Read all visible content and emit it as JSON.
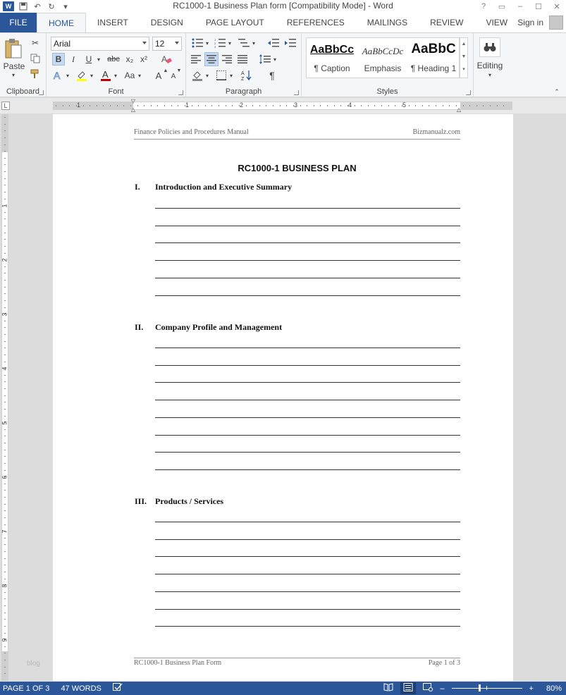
{
  "window": {
    "title": "RC1000-1 Business Plan form [Compatibility Mode] - Word",
    "controls": [
      "?",
      "▭",
      "–",
      "☐",
      "✕"
    ]
  },
  "ribbon_tabs": {
    "file": "FILE",
    "tabs": [
      "HOME",
      "INSERT",
      "DESIGN",
      "PAGE LAYOUT",
      "REFERENCES",
      "MAILINGS",
      "REVIEW",
      "VIEW"
    ],
    "active": "HOME",
    "sign_in": "Sign in"
  },
  "ribbon": {
    "clipboard": {
      "label": "Clipboard",
      "paste_label": "Paste"
    },
    "font": {
      "label": "Font",
      "font_name": "Arial",
      "font_size": "12",
      "bold": "B",
      "italic": "I",
      "underline": "U",
      "strike": "abc",
      "subscript": "x₂",
      "superscript": "x²",
      "grow": "A",
      "shrink": "A",
      "change_case": "Aa",
      "font_color": "A"
    },
    "paragraph": {
      "label": "Paragraph",
      "pilcrow": "¶"
    },
    "styles": {
      "label": "Styles",
      "items": [
        {
          "sample": "AaBbCc",
          "name": "¶ Caption"
        },
        {
          "sample": "AaBbCcDc",
          "name": "Emphasis"
        },
        {
          "sample": "AaBbC",
          "name": "¶ Heading 1"
        }
      ]
    },
    "editing": {
      "label": "Editing"
    }
  },
  "ruler": {
    "h_numbers": [
      "1",
      "1",
      "2",
      "3",
      "4",
      "5"
    ],
    "v_numbers": [
      "1",
      "2",
      "3",
      "4",
      "5",
      "6",
      "7",
      "8",
      "9"
    ]
  },
  "document": {
    "header_left": "Finance Policies and Procedures Manual",
    "header_right": "Bizmanualz.com",
    "title": "RC1000-1 BUSINESS PLAN",
    "sections": [
      {
        "num": "I.",
        "title": "Introduction and Executive Summary",
        "lines": 6
      },
      {
        "num": "II.",
        "title": "Company Profile and Management",
        "lines": 8
      },
      {
        "num": "III.",
        "title": "Products / Services",
        "lines": 7
      }
    ],
    "footer_left": "RC1000-1 Business Plan Form",
    "footer_right": "Page 1 of 3"
  },
  "watermark": "blog",
  "status": {
    "page": "PAGE 1 OF 3",
    "words": "47 WORDS",
    "zoom": "80%",
    "zoom_minus": "–",
    "zoom_plus": "+"
  },
  "colors": {
    "accent": "#2b579a",
    "font_color_bar": "#c00000",
    "highlight_bar": "#ffff00"
  }
}
